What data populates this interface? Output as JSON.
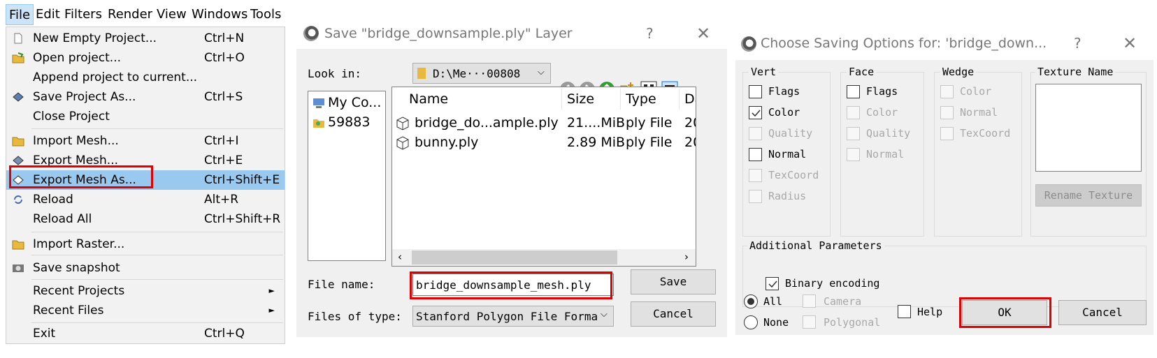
{
  "menubar": {
    "items": [
      "File",
      "Edit",
      "Filters",
      "Render",
      "View",
      "Windows",
      "Tools"
    ]
  },
  "file_menu": {
    "items": [
      {
        "label": "New Empty Project...",
        "shortcut": "Ctrl+N",
        "icon": "new-doc-icon"
      },
      {
        "label": "Open project...",
        "shortcut": "Ctrl+O",
        "icon": "open-folder-icon"
      },
      {
        "label": "Append project to current...",
        "shortcut": "",
        "icon": ""
      },
      {
        "label": "Save Project As...",
        "shortcut": "Ctrl+S",
        "icon": "save-diamond-icon"
      },
      {
        "label": "Close Project",
        "shortcut": "",
        "icon": ""
      },
      {
        "label": "Import Mesh...",
        "shortcut": "Ctrl+I",
        "icon": "folder-icon"
      },
      {
        "label": "Export Mesh...",
        "shortcut": "Ctrl+E",
        "icon": "export-diamond-icon"
      },
      {
        "label": "Export Mesh As...",
        "shortcut": "Ctrl+Shift+E",
        "icon": "export-as-icon"
      },
      {
        "label": "Reload",
        "shortcut": "Alt+R",
        "icon": "reload-icon"
      },
      {
        "label": "Reload All",
        "shortcut": "Ctrl+Shift+R",
        "icon": ""
      },
      {
        "label": "Import Raster...",
        "shortcut": "",
        "icon": "folder-icon"
      },
      {
        "label": "Save snapshot",
        "shortcut": "",
        "icon": "camera-icon"
      },
      {
        "label": "Recent Projects",
        "shortcut": "",
        "icon": ""
      },
      {
        "label": "Recent Files",
        "shortcut": "",
        "icon": ""
      },
      {
        "label": "Exit",
        "shortcut": "Ctrl+Q",
        "icon": ""
      }
    ]
  },
  "save_dialog": {
    "title": "Save \"bridge_downsample.ply\" Layer",
    "look_in_label": "Look in:",
    "look_in_value": "D:\\Me···00808",
    "sidebar": [
      "My Co...",
      "59883"
    ],
    "columns": [
      "Name",
      "Size",
      "Type",
      "Dä"
    ],
    "files": [
      {
        "name": "bridge_do...ample.ply",
        "size": "21....MiB",
        "type": "ply File",
        "date": "20"
      },
      {
        "name": "bunny.ply",
        "size": "2.89 MiB",
        "type": "ply File",
        "date": "20"
      }
    ],
    "file_name_label": "File name:",
    "file_name_value": "bridge_downsample_mesh.ply",
    "file_type_label": "Files of type:",
    "file_type_value": "Stanford Polygon File Forma",
    "save_label": "Save",
    "cancel_label": "Cancel"
  },
  "options_dialog": {
    "title": "Choose Saving Options for: 'bridge_down...",
    "vert": {
      "title": "Vert",
      "items": [
        {
          "label": "Flags",
          "checked": false,
          "enabled": true
        },
        {
          "label": "Color",
          "checked": true,
          "enabled": true
        },
        {
          "label": "Quality",
          "checked": false,
          "enabled": false
        },
        {
          "label": "Normal",
          "checked": false,
          "enabled": true
        },
        {
          "label": "TexCoord",
          "checked": false,
          "enabled": false
        },
        {
          "label": "Radius",
          "checked": false,
          "enabled": false
        }
      ]
    },
    "face": {
      "title": "Face",
      "items": [
        {
          "label": "Flags",
          "checked": false,
          "enabled": true
        },
        {
          "label": "Color",
          "checked": false,
          "enabled": false
        },
        {
          "label": "Quality",
          "checked": false,
          "enabled": false
        },
        {
          "label": "Normal",
          "checked": false,
          "enabled": false
        }
      ]
    },
    "wedge": {
      "title": "Wedge",
      "items": [
        {
          "label": "Color",
          "checked": false,
          "enabled": false
        },
        {
          "label": "Normal",
          "checked": false,
          "enabled": false
        },
        {
          "label": "TexCoord",
          "checked": false,
          "enabled": false
        }
      ]
    },
    "texture_title": "Texture Name",
    "rename_texture": "Rename Texture",
    "additional_title": "Additional Parameters",
    "binary_encoding": "Binary encoding",
    "all_label": "All",
    "none_label": "None",
    "camera_label": "Camera",
    "polygonal_label": "Polygonal",
    "help_label": "Help",
    "ok_label": "OK",
    "cancel_label": "Cancel"
  },
  "colors": {
    "highlight": "#99c9ef",
    "red_box": "#e00000"
  }
}
